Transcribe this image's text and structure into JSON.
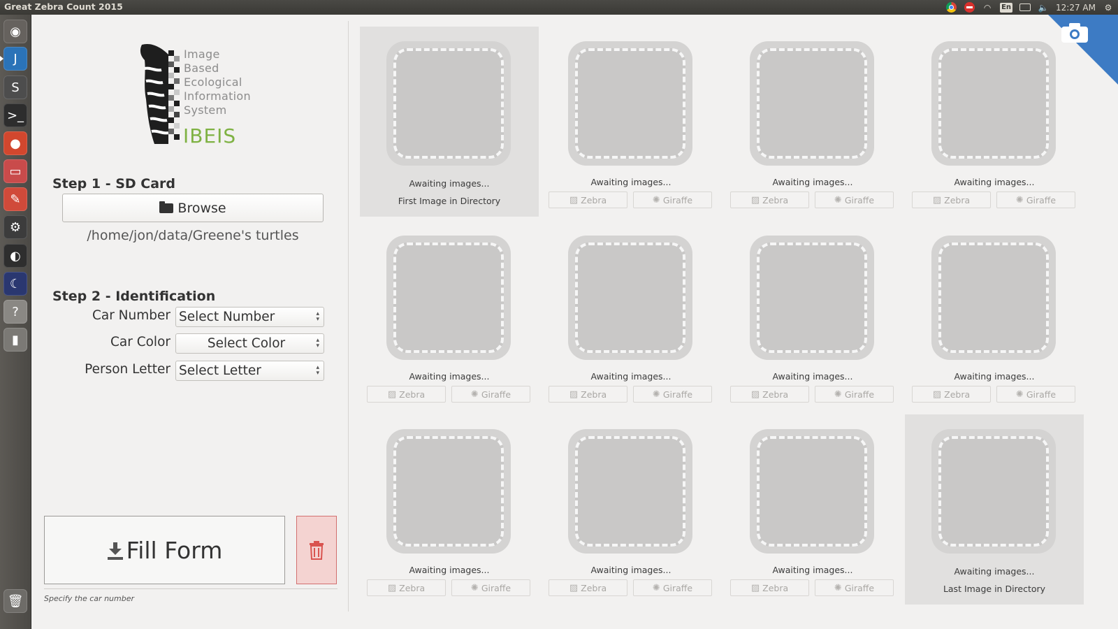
{
  "window": {
    "title": "Great Zebra Count 2015"
  },
  "tray": {
    "lang": "En",
    "time": "12:27 AM"
  },
  "launcher": {
    "items": [
      {
        "name": "dash-icon",
        "glyph": "◉",
        "bg": "#66625e"
      },
      {
        "name": "pycharm-icon",
        "glyph": "J",
        "bg": "#2b73b8"
      },
      {
        "name": "sublime-text-icon",
        "glyph": "S",
        "bg": "#4d4d4d"
      },
      {
        "name": "terminal-icon",
        "glyph": ">_",
        "bg": "#2d2d2d"
      },
      {
        "name": "chrome-icon",
        "glyph": "●",
        "bg": "#d2472e"
      },
      {
        "name": "files-icon",
        "glyph": "▭",
        "bg": "#c94b4b"
      },
      {
        "name": "system-settings-icon",
        "glyph": "✎",
        "bg": "#d04a3a"
      },
      {
        "name": "steam-icon",
        "glyph": "⚙",
        "bg": "#3c3c3c"
      },
      {
        "name": "ibeis-app-icon",
        "glyph": "◐",
        "bg": "#2e2e2e"
      },
      {
        "name": "stellarium-icon",
        "glyph": "☾",
        "bg": "#2a3770"
      },
      {
        "name": "help-icon",
        "glyph": "?",
        "bg": "#8a8884"
      },
      {
        "name": "usb-drive-icon",
        "glyph": "▮",
        "bg": "#7b7975"
      },
      {
        "name": "trash-bin-icon",
        "glyph": "🗑",
        "bg": "#6e6c68"
      }
    ]
  },
  "logo": {
    "lines": [
      "Image",
      "Based",
      "Ecological",
      "Information",
      "System"
    ],
    "name": "IBEIS"
  },
  "step1": {
    "title": "Step 1 - SD Card",
    "browse_label": "Browse",
    "path": "/home/jon/data/Greene's turtles"
  },
  "step2": {
    "title": "Step 2 - Identification",
    "car_number_label": "Car Number",
    "car_number_value": "Select Number",
    "car_color_label": "Car Color",
    "car_color_value": "Select Color",
    "person_letter_label": "Person Letter",
    "person_letter_value": "Select Letter"
  },
  "actions": {
    "fill_form_label": "Fill Form"
  },
  "hint": "Specify the car number",
  "grid": {
    "awaiting": "Awaiting images...",
    "first_label": "First Image in Directory",
    "last_label": "Last Image in Directory",
    "zebra_label": "Zebra",
    "giraffe_label": "Giraffe"
  },
  "colors": {
    "accent_blue": "#3d7bc4",
    "ibeis_green": "#7fb243",
    "trash_red": "#d26f6f"
  }
}
